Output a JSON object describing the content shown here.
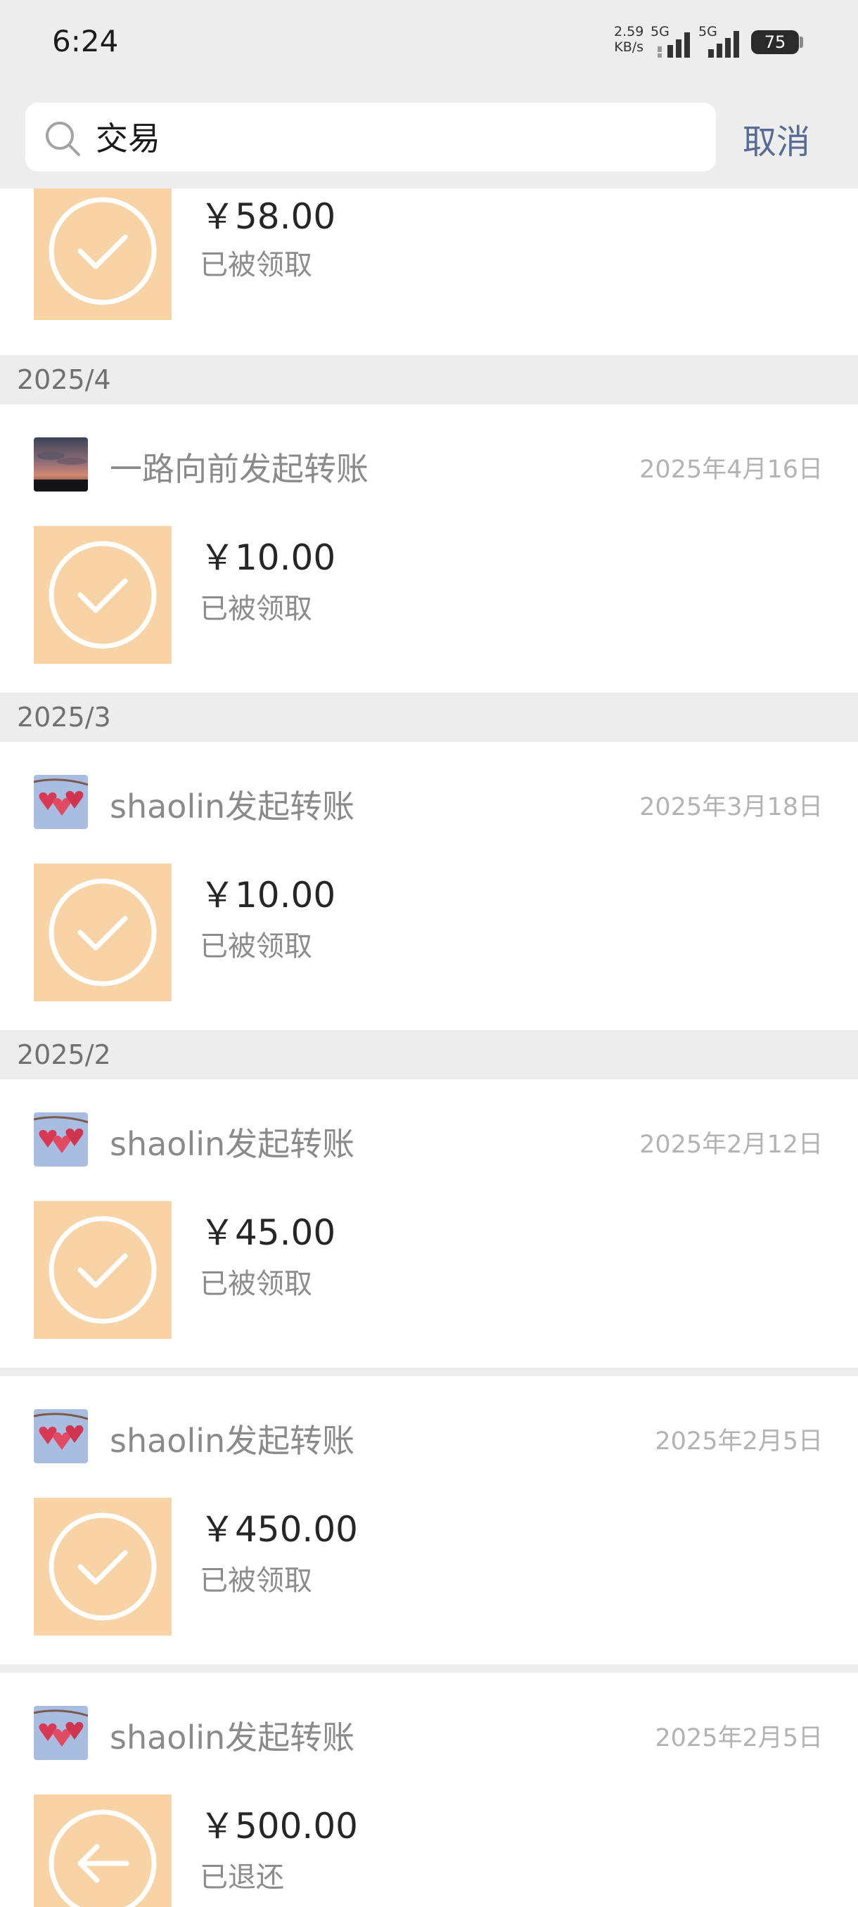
{
  "status_bar": {
    "time": "6:24",
    "net_speed_value": "2.59",
    "net_speed_unit": "KB/s",
    "sim1": "5G",
    "sim2": "5G",
    "battery": "75"
  },
  "search": {
    "value": "交易",
    "cancel_label": "取消"
  },
  "colors": {
    "accent": "#576b95",
    "tile": "#f8d3a5",
    "background": "#ededed"
  },
  "top_card": {
    "amount": "￥58.00",
    "state": "已被领取",
    "icon": "check-circle-icon"
  },
  "groups": [
    {
      "month": "2025/4",
      "items": [
        {
          "sender": "一路向前发起转账",
          "date": "2025年4月16日",
          "amount": "￥10.00",
          "state": "已被领取",
          "avatar": "sunset-avatar",
          "icon": "check-circle-icon"
        }
      ]
    },
    {
      "month": "2025/3",
      "items": [
        {
          "sender": "shaolin发起转账",
          "date": "2025年3月18日",
          "amount": "￥10.00",
          "state": "已被领取",
          "avatar": "hearts-avatar",
          "icon": "check-circle-icon"
        }
      ]
    },
    {
      "month": "2025/2",
      "items": [
        {
          "sender": "shaolin发起转账",
          "date": "2025年2月12日",
          "amount": "￥45.00",
          "state": "已被领取",
          "avatar": "hearts-avatar",
          "icon": "check-circle-icon"
        },
        {
          "sender": "shaolin发起转账",
          "date": "2025年2月5日",
          "amount": "￥450.00",
          "state": "已被领取",
          "avatar": "hearts-avatar",
          "icon": "check-circle-icon"
        },
        {
          "sender": "shaolin发起转账",
          "date": "2025年2月5日",
          "amount": "￥500.00",
          "state": "已退还",
          "avatar": "hearts-avatar",
          "icon": "return-circle-icon"
        }
      ]
    }
  ]
}
